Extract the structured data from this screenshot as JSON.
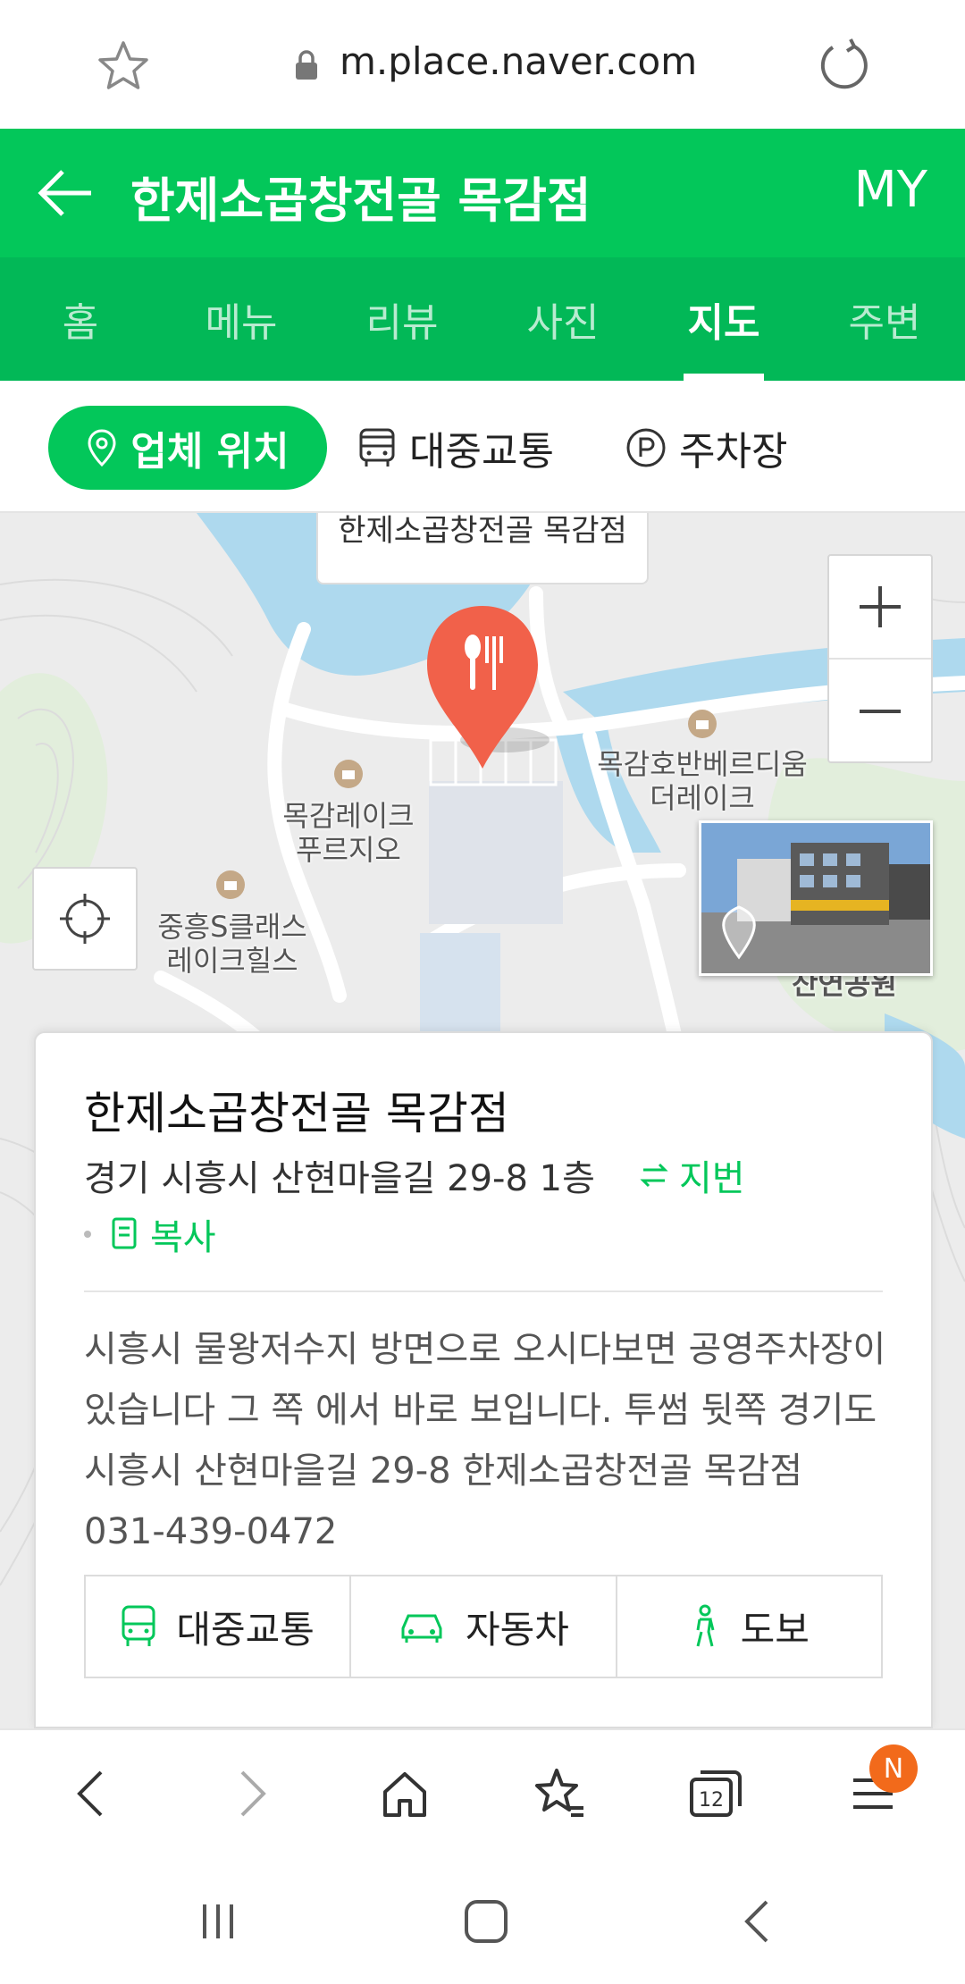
{
  "browser": {
    "url": "m.place.naver.com",
    "icons": [
      "star-icon",
      "lock-icon",
      "reload-icon"
    ]
  },
  "header": {
    "title": "한제소곱창전골 목감점",
    "my_label": "MY"
  },
  "tabs": [
    {
      "label": "홈",
      "active": false
    },
    {
      "label": "메뉴",
      "active": false
    },
    {
      "label": "리뷰",
      "active": false
    },
    {
      "label": "사진",
      "active": false
    },
    {
      "label": "지도",
      "active": true
    },
    {
      "label": "주변",
      "active": false
    }
  ],
  "filters": {
    "location": "업체 위치",
    "transit": "대중교통",
    "parking": "주차장"
  },
  "map": {
    "callout": "한제소곱창전골 목감점",
    "labels": {
      "lake_fourgio": "목감레이크\n푸르지오",
      "hoban": "목감호반베르디움\n더레이크",
      "jungheung": "중흥S클래스\n레이크힐스",
      "park": "산연공원"
    },
    "colors": {
      "water": "#aed9ee",
      "land": "#ececec",
      "green": "#e2eedc",
      "marker": "#f1614a"
    }
  },
  "place": {
    "name": "한제소곱창전골 목감점",
    "address": "경기 시흥시 산현마을길 29-8 1층",
    "jibun": "지번",
    "copy": "복사",
    "description": "시흥시 물왕저수지 방면으로 오시다보면 공영주차장이 있습니다 그 쪽 에서 바로 보입니다. 투썸 뒷쪽 경기도 시흥시 산현마을길 29-8 한제소곱창전골 목감점 031-439-0472",
    "modes": {
      "transit": "대중교통",
      "car": "자동차",
      "walk": "도보"
    }
  },
  "bottom_bar": {
    "tab_count": "12",
    "badge": "N"
  },
  "accent": "#03c75a"
}
